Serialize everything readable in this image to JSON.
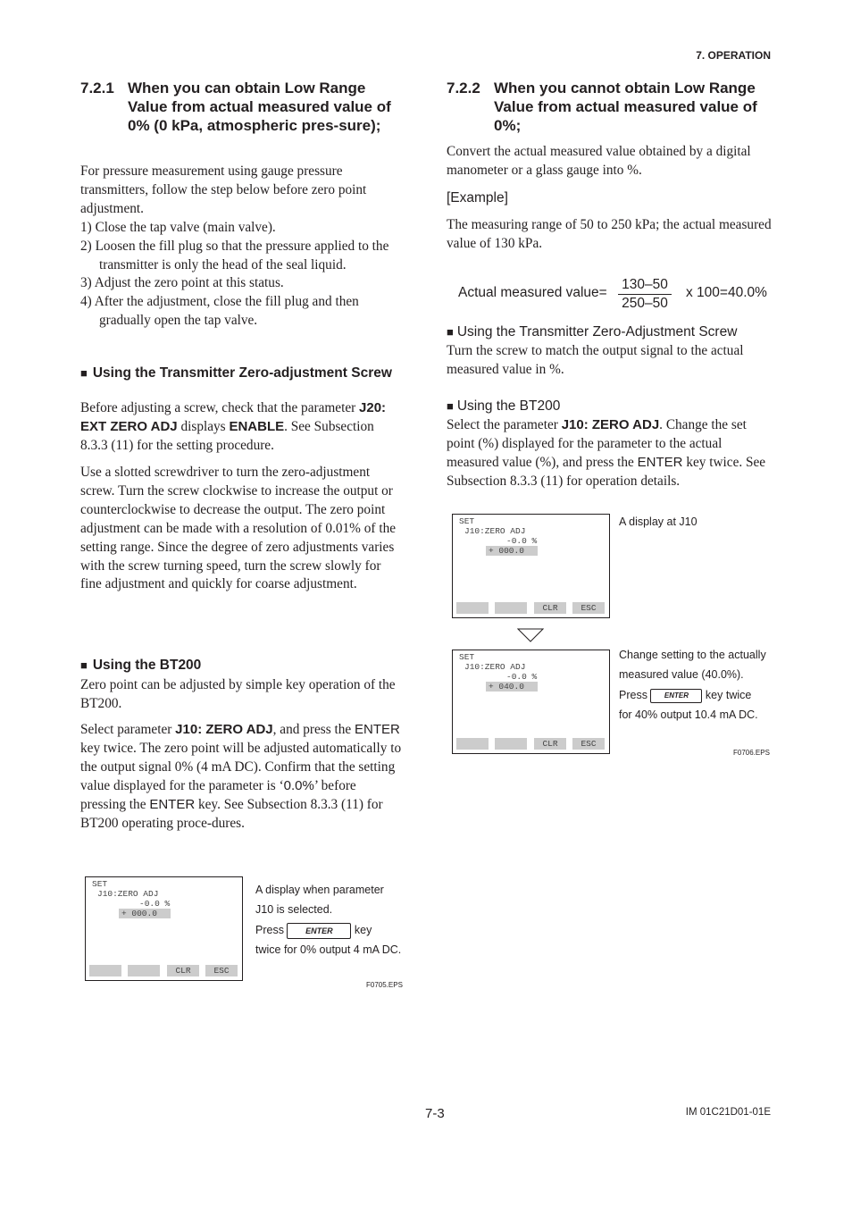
{
  "header": {
    "section": "7.  OPERATION"
  },
  "left": {
    "heading": {
      "number": "7.2.1",
      "text": "When you can obtain Low Range Value from actual measured value of 0% (0 kPa, atmospheric pres-sure);"
    },
    "intro": "For pressure measurement using gauge pressure transmitters, follow the step below before zero point adjustment.",
    "steps": [
      "1) Close the tap valve (main valve).",
      "2) Loosen the fill plug so that the pressure applied to the transmitter is only the head of the seal liquid.",
      "3) Adjust the zero point at this status.",
      "4) After the adjustment, close the fill plug and then gradually open the tap valve."
    ],
    "screw": {
      "title": "Using the Transmitter Zero-adjustment Screw",
      "p1": [
        "Before adjusting a screw, check that the parameter ",
        "J20: EXT ZERO ADJ",
        " displays ",
        "ENABLE",
        ".  See Subsection 8.3.3 (11) for the setting procedure."
      ],
      "p2": "Use a slotted screwdriver to turn the zero-adjustment screw. Turn the screw clockwise to increase the output or counterclockwise to decrease the output. The zero point adjustment can be made with a resolution of 0.01% of the setting range. Since the degree of zero adjustments varies with the screw turning speed, turn the screw slowly for fine adjustment and quickly for coarse adjustment."
    },
    "bt200": {
      "title": "Using the BT200",
      "p1": "Zero point can be adjusted by simple key operation of the BT200.",
      "p2": [
        "Select parameter ",
        "J10: ZERO ADJ",
        ", and press the ",
        "ENTER",
        " key twice. The zero point will be adjusted automatically to the output signal 0% (4 mA DC). Confirm that the setting value displayed for the parameter is ‘",
        "0.0%",
        "’ before pressing the ",
        "ENTER",
        " key. See Subsection 8.3.3 (11) for BT200 operating proce-dures."
      ]
    },
    "figure": {
      "lcd": {
        "l1": "SET",
        "l2": "J10:ZERO ADJ",
        "l3": "-0.0 %",
        "l4": "+ 000.0",
        "keys": [
          "",
          "",
          "CLR",
          "ESC"
        ]
      },
      "caption": [
        "A display when parameter",
        "J10 is selected.",
        "Press",
        "key",
        "twice for 0% output 4 mA DC."
      ],
      "enter": "ENTER",
      "id": "F0705.EPS"
    }
  },
  "right": {
    "heading": {
      "number": "7.2.2",
      "text": "When you cannot obtain Low Range Value from actual measured value of 0%;"
    },
    "p1": "Convert the actual measured value obtained by a digital manometer or a glass gauge into %.",
    "example": "[Example]",
    "p2": "The measuring range of 50 to 250 kPa; the actual measured value of 130 kPa.",
    "formula": {
      "label": "Actual measured value=",
      "numerator": "130–50",
      "denominator": "250–50",
      "result": "x 100=40.0%"
    },
    "screw": {
      "title": "Using the Transmitter Zero-Adjustment Screw",
      "p": "Turn the screw to match the output signal to the actual measured value in %."
    },
    "bt200": {
      "title": "Using the BT200",
      "p": [
        "Select the parameter ",
        "J10: ZERO ADJ",
        ".  Change the set point (%) displayed for the parameter to the actual measured value (%), and press the ",
        "ENTER",
        " key twice. See Subsection 8.3.3 (11) for operation details."
      ]
    },
    "figure": {
      "lcd1": {
        "l1": "SET",
        "l2": "J10:ZERO ADJ",
        "l3": "-0.0 %",
        "l4": "+ 000.0",
        "keys": [
          "",
          "",
          "CLR",
          "ESC"
        ]
      },
      "caption1": "A display at J10",
      "lcd2": {
        "l1": "SET",
        "l2": "J10:ZERO ADJ",
        "l3": "-0.0 %",
        "l4": "+ 040.0",
        "keys": [
          "",
          "",
          "CLR",
          "ESC"
        ]
      },
      "caption2": [
        "Change setting to the actually",
        "measured value (40.0%).",
        "Press",
        "key twice",
        "for 40% output 10.4 mA DC."
      ],
      "enter": "ENTER",
      "id": "F0706.EPS"
    }
  },
  "footer": {
    "page": "7-3",
    "doc": "IM 01C21D01-01E"
  }
}
